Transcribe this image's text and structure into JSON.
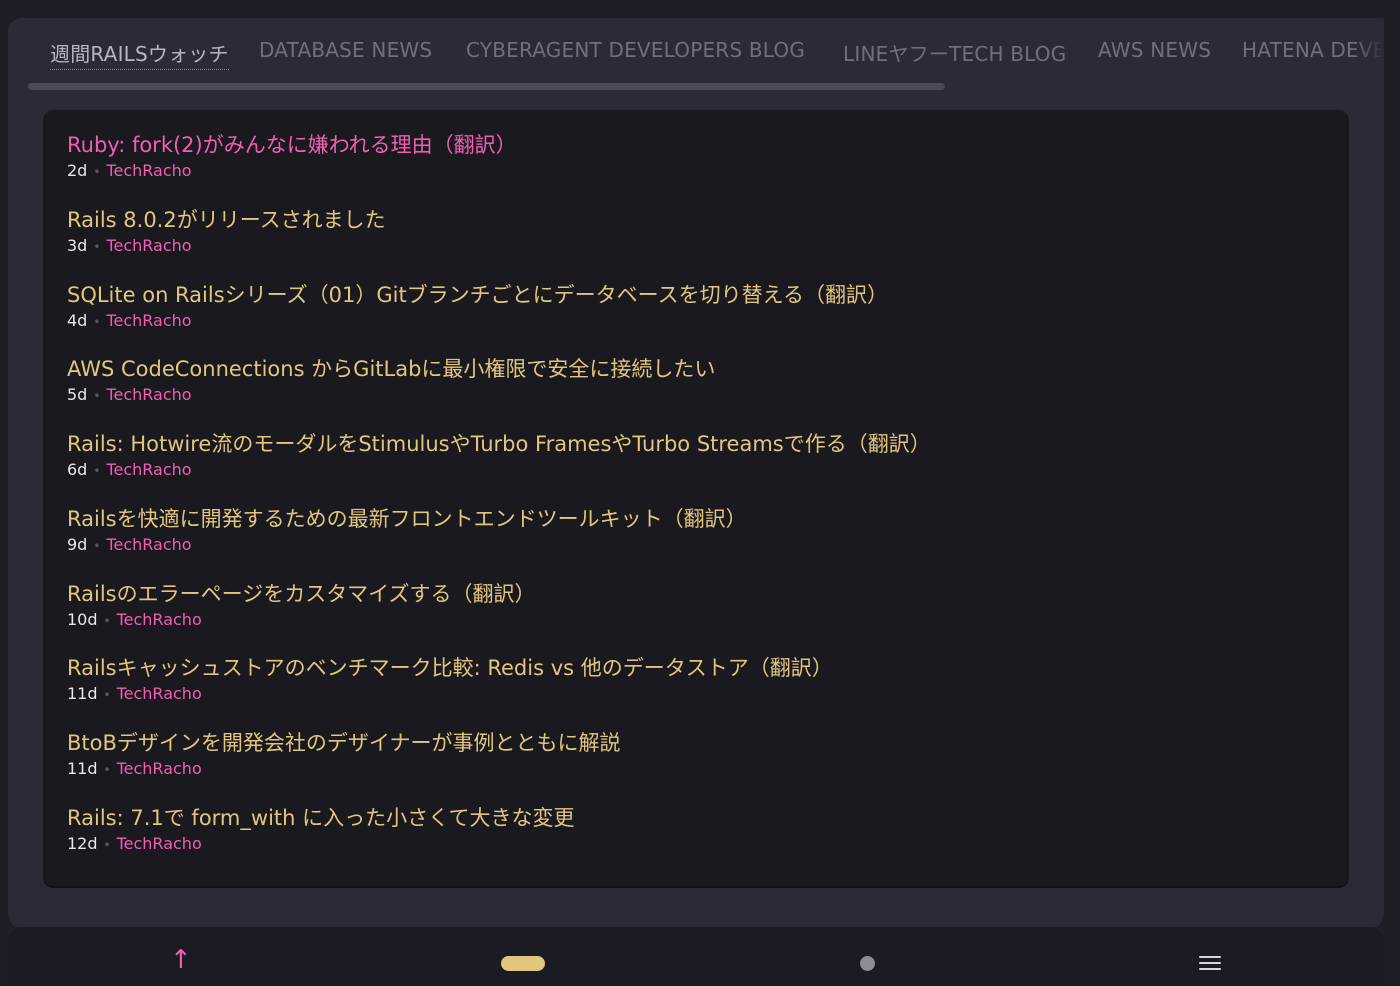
{
  "tabs": [
    {
      "label": "週間RAILSウォッチ",
      "active": true
    },
    {
      "label": "DATABASE NEWS"
    },
    {
      "label": "CYBERAGENT DEVELOPERS BLOG"
    },
    {
      "label": "LINEヤフーTECH BLOG"
    },
    {
      "label": "AWS NEWS"
    },
    {
      "label": "HATENA DEVELOPER BLOG"
    }
  ],
  "articles": [
    {
      "title": "Ruby: fork(2)がみんなに嫌われる理由（翻訳）",
      "age": "2d",
      "source": "TechRacho",
      "visited": true
    },
    {
      "title": "Rails 8.0.2がリリースされました",
      "age": "3d",
      "source": "TechRacho"
    },
    {
      "title": "SQLite on Railsシリーズ（01）Gitブランチごとにデータベースを切り替える（翻訳）",
      "age": "4d",
      "source": "TechRacho"
    },
    {
      "title": "AWS CodeConnections からGitLabに最小権限で安全に接続したい",
      "age": "5d",
      "source": "TechRacho"
    },
    {
      "title": "Rails: Hotwire流のモーダルをStimulusやTurbo FramesやTurbo Streamsで作る（翻訳）",
      "age": "6d",
      "source": "TechRacho"
    },
    {
      "title": "Railsを快適に開発するための最新フロントエンドツールキット（翻訳）",
      "age": "9d",
      "source": "TechRacho"
    },
    {
      "title": "Railsのエラーページをカスタマイズする（翻訳）",
      "age": "10d",
      "source": "TechRacho"
    },
    {
      "title": "Railsキャッシュストアのベンチマーク比較: Redis vs 他のデータストア（翻訳）",
      "age": "11d",
      "source": "TechRacho"
    },
    {
      "title": "BtoBデザインを開発会社のデザイナーが事例とともに解説",
      "age": "11d",
      "source": "TechRacho"
    },
    {
      "title": "Rails: 7.1で form_with に入った小さくて大きな変更",
      "age": "12d",
      "source": "TechRacho"
    }
  ],
  "meta_separator": "•",
  "bottom_nav": {
    "up_icon": "arrow-up-icon",
    "up_glyph": "↑",
    "pill_icon": "pill-icon",
    "circle_icon": "circle-icon",
    "menu_icon": "hamburger-menu-icon"
  },
  "colors": {
    "accent_pink": "#f25fb1",
    "title_gold": "#e3c67e",
    "background": "#1e1e26",
    "panel": "#19191f"
  }
}
